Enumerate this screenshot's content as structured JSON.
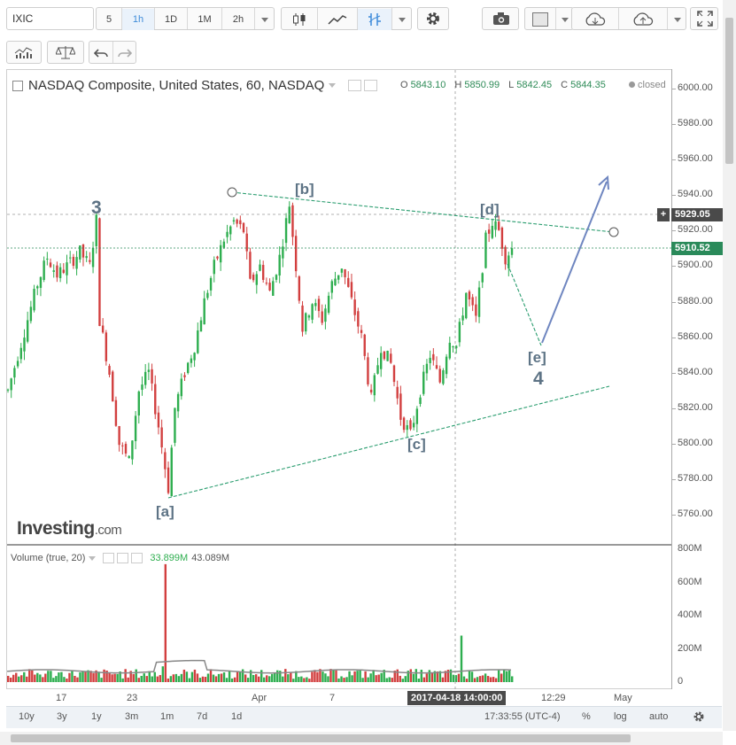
{
  "toolbar": {
    "symbol": "IXIC",
    "intervals": [
      "5",
      "1h",
      "1D",
      "1M",
      "2h"
    ],
    "active_interval": "1h",
    "icons": [
      "candles-icon",
      "line-chart-icon",
      "indicator-icon",
      "settings-icon",
      "camera-icon",
      "color-icon",
      "cloud-download-icon",
      "cloud-upload-icon",
      "fullscreen-icon"
    ]
  },
  "toolbar2": {
    "icons": [
      "bar-chart-icon",
      "compare-icon",
      "undo-icon",
      "redo-icon"
    ]
  },
  "legend": {
    "title": "NASDAQ Composite, United States, 60, NASDAQ",
    "ohlc": [
      {
        "k": "O",
        "v": "5843.10"
      },
      {
        "k": "H",
        "v": "5850.99"
      },
      {
        "k": "L",
        "v": "5842.45"
      },
      {
        "k": "C",
        "v": "5844.35"
      }
    ],
    "status": "closed"
  },
  "volume_legend": {
    "title": "Volume (true, 20)",
    "v1": "33.899M",
    "v2": "43.089M"
  },
  "price_axis": [
    "6000.00",
    "5980.00",
    "5960.00",
    "5940.00",
    "5920.00",
    "5900.00",
    "5880.00",
    "5860.00",
    "5840.00",
    "5820.00",
    "5800.00",
    "5780.00",
    "5760.00"
  ],
  "volume_axis": [
    "800M",
    "600M",
    "400M",
    "200M",
    "0"
  ],
  "price_tags": {
    "crosshair": "5929.05",
    "last": "5910.52"
  },
  "time_axis": [
    "17",
    "23",
    "Apr",
    "7",
    "12:29",
    "May"
  ],
  "crosshair_time": "2017-04-18 14:00:00",
  "annotations": {
    "wave_3": "3",
    "a": "[a]",
    "b": "[b]",
    "c": "[c]",
    "d": "[d]",
    "e": "[e]",
    "wave_4": "4"
  },
  "watermark": {
    "brand": "Investing",
    "suffix": ".com"
  },
  "bottom_bar": {
    "ranges": [
      "10y",
      "3y",
      "1y",
      "3m",
      "1m",
      "7d",
      "1d"
    ],
    "clock": "17:33:55 (UTC-4)",
    "options": [
      "%",
      "log",
      "auto"
    ]
  },
  "colors": {
    "up": "#2eae4f",
    "down": "#d23f3f",
    "trend": "#2a9d6f",
    "arrow": "#6f86c0",
    "label": "#5d7385",
    "accent": "#3d8bd9"
  },
  "chart_data": {
    "type": "candlestick",
    "ylim": [
      5750,
      6010
    ],
    "yticks": [
      5760,
      5780,
      5800,
      5820,
      5840,
      5860,
      5880,
      5900,
      5920,
      5940,
      5960,
      5980,
      6000
    ],
    "swing_path": [
      [
        0,
        5830
      ],
      [
        3,
        5850
      ],
      [
        6,
        5870
      ],
      [
        9,
        5890
      ],
      [
        12,
        5905
      ],
      [
        15,
        5895
      ],
      [
        18,
        5900
      ],
      [
        22,
        5908
      ],
      [
        25,
        5900
      ],
      [
        27,
        5926
      ],
      [
        28,
        5870
      ],
      [
        31,
        5840
      ],
      [
        34,
        5800
      ],
      [
        37,
        5790
      ],
      [
        40,
        5830
      ],
      [
        43,
        5840
      ],
      [
        46,
        5810
      ],
      [
        49,
        5775
      ],
      [
        51,
        5820
      ],
      [
        54,
        5840
      ],
      [
        57,
        5855
      ],
      [
        60,
        5880
      ],
      [
        63,
        5900
      ],
      [
        66,
        5915
      ],
      [
        69,
        5925
      ],
      [
        72,
        5920
      ],
      [
        74,
        5890
      ],
      [
        77,
        5900
      ],
      [
        80,
        5885
      ],
      [
        83,
        5905
      ],
      [
        86,
        5935
      ],
      [
        88,
        5900
      ],
      [
        90,
        5865
      ],
      [
        93,
        5880
      ],
      [
        96,
        5870
      ],
      [
        99,
        5890
      ],
      [
        102,
        5900
      ],
      [
        105,
        5880
      ],
      [
        108,
        5860
      ],
      [
        111,
        5825
      ],
      [
        114,
        5855
      ],
      [
        117,
        5845
      ],
      [
        120,
        5815
      ],
      [
        123,
        5805
      ],
      [
        126,
        5830
      ],
      [
        129,
        5850
      ],
      [
        132,
        5835
      ],
      [
        135,
        5860
      ],
      [
        137,
        5855
      ],
      [
        140,
        5885
      ],
      [
        143,
        5870
      ],
      [
        146,
        5915
      ],
      [
        148,
        5925
      ],
      [
        150,
        5920
      ],
      [
        152,
        5905
      ],
      [
        154,
        5910
      ]
    ],
    "volume_spikes": [
      [
        58,
        95
      ],
      [
        59,
        710
      ],
      [
        170,
        280
      ]
    ],
    "price_tags": [
      5929.05,
      5910.52
    ]
  }
}
